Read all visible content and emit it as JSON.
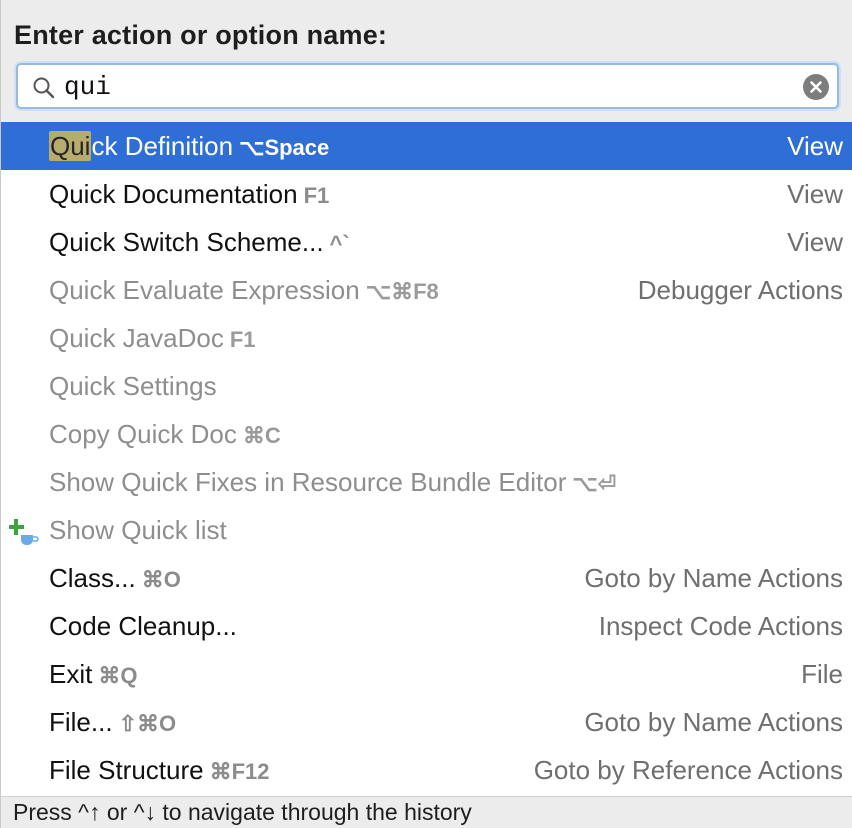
{
  "header": {
    "title": "Enter action or option name:"
  },
  "search": {
    "value": "qui",
    "icon": "search-icon",
    "clear_icon": "clear-icon"
  },
  "results": [
    {
      "prefix": "Qui",
      "rest": "ck Definition",
      "shortcut": "⌥Space",
      "group": "View",
      "enabled": true,
      "selected": true
    },
    {
      "prefix": "",
      "rest": "Quick Documentation",
      "shortcut": "F1",
      "group": "View",
      "enabled": true,
      "selected": false
    },
    {
      "prefix": "",
      "rest": "Quick Switch Scheme...",
      "shortcut": "^`",
      "group": "View",
      "enabled": true,
      "selected": false
    },
    {
      "prefix": "",
      "rest": "Quick Evaluate Expression",
      "shortcut": "⌥⌘F8",
      "group": "Debugger Actions",
      "enabled": false,
      "selected": false
    },
    {
      "prefix": "",
      "rest": "Quick JavaDoc",
      "shortcut": "F1",
      "group": "",
      "enabled": false,
      "selected": false
    },
    {
      "prefix": "",
      "rest": "Quick Settings",
      "shortcut": "",
      "group": "",
      "enabled": false,
      "selected": false
    },
    {
      "prefix": "",
      "rest": "Copy Quick Doc",
      "shortcut": "⌘C",
      "group": "",
      "enabled": false,
      "selected": false
    },
    {
      "prefix": "",
      "rest": "Show Quick Fixes in Resource Bundle Editor",
      "shortcut": "⌥⏎",
      "group": "",
      "enabled": false,
      "selected": false
    },
    {
      "prefix": "",
      "rest": "Show Quick list",
      "shortcut": "",
      "group": "",
      "enabled": false,
      "selected": false,
      "icon": "add-coffee-icon"
    },
    {
      "prefix": "",
      "rest": "Class...",
      "shortcut": "⌘O",
      "group": "Goto by Name Actions",
      "enabled": true,
      "selected": false
    },
    {
      "prefix": "",
      "rest": "Code Cleanup...",
      "shortcut": "",
      "group": "Inspect Code Actions",
      "enabled": true,
      "selected": false
    },
    {
      "prefix": "",
      "rest": "Exit",
      "shortcut": "⌘Q",
      "group": "File",
      "enabled": true,
      "selected": false
    },
    {
      "prefix": "",
      "rest": "File...",
      "shortcut": "⇧⌘O",
      "group": "Goto by Name Actions",
      "enabled": true,
      "selected": false
    },
    {
      "prefix": "",
      "rest": "File Structure",
      "shortcut": "⌘F12",
      "group": "Goto by Reference Actions",
      "enabled": true,
      "selected": false
    }
  ],
  "footer": {
    "hint": "Press ^↑ or ^↓ to navigate through the history"
  },
  "colors": {
    "selection": "#2f6fd5",
    "match_highlight": "#b7ab6e",
    "header_bg": "#ececec"
  }
}
